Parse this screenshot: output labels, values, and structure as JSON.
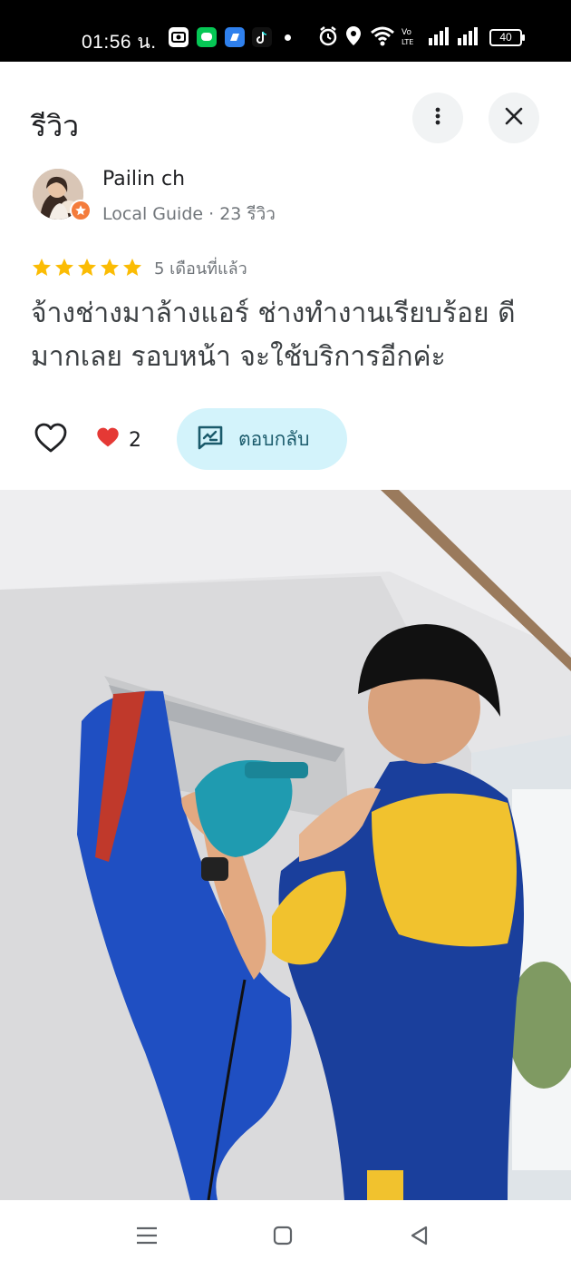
{
  "status_bar": {
    "time": "01:56 น.",
    "battery": "40",
    "icons": [
      "gallery-app-icon",
      "line-app-icon",
      "messenger-app-icon",
      "tiktok-app-icon",
      "alarm-icon",
      "location-icon",
      "wifi-icon",
      "volte-icon",
      "signal-icon",
      "signal-icon",
      "battery-icon"
    ]
  },
  "header": {
    "title": "รีวิว",
    "more_icon": "more-vert-icon",
    "close_icon": "close-icon"
  },
  "author": {
    "name": "Pailin ch",
    "meta": "Local Guide · 23 รีวิว",
    "badge_icon": "local-guide-star-icon"
  },
  "review": {
    "rating": 5,
    "max_rating": 5,
    "time_ago": "5 เดือนที่แล้ว",
    "text": "จ้างช่างมาล้างแอร์ ช่างทำงานเรียบร้อย ดีมากเลย รอบหน้า จะใช้บริการอีกค่ะ",
    "star_color": "#fbbc04"
  },
  "actions": {
    "like_icon": "heart-outline-icon",
    "reaction_icon": "red-heart-icon",
    "reaction_count": "2",
    "reply_label": "ตอบกลับ",
    "reply_icon": "reply-icon",
    "reply_bg": "#d3f3fb"
  },
  "photo": {
    "subject": "photo-technician-cleaning-air-conditioner"
  },
  "nav_bar": {
    "buttons": [
      "recent-apps-icon",
      "home-icon",
      "back-icon"
    ]
  }
}
